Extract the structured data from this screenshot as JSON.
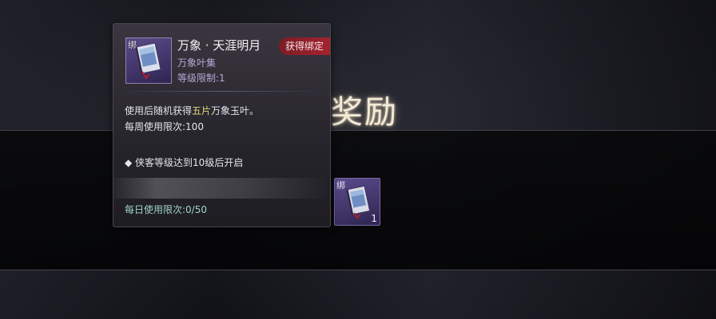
{
  "screen": {
    "title": "获得奖励"
  },
  "reward": {
    "bind_label": "绑",
    "count": "1",
    "icon": "book-icon"
  },
  "tooltip": {
    "bind_label": "绑",
    "item_name": "万象 · 天涯明月",
    "badge": "获得绑定",
    "category": "万象叶集",
    "level_requirement": "等级限制:1",
    "desc_prefix": "使用后随机获得",
    "desc_highlight": "五片",
    "desc_suffix": "万象玉叶。",
    "weekly_limit": "每周使用限次:100",
    "condition": "◆ 侠客等级达到10级后开启",
    "daily_limit": "每日使用限次:0/50",
    "colors": {
      "badge": "#a3242f",
      "highlight": "#e6d77a",
      "daily": "#9fd2c8",
      "slot": "#5b4b8c"
    }
  }
}
